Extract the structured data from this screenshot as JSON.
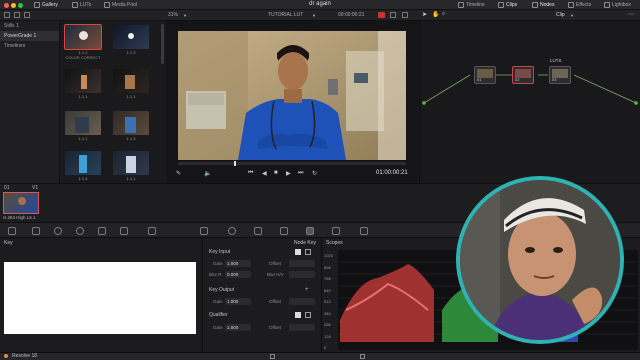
{
  "app": {
    "project_title": "dr again",
    "tabs": {
      "gallery": "Gallery",
      "luts": "LUTs",
      "media_pool": "Media Pool",
      "timeline": "Timeline",
      "clips": "Clips",
      "nodes": "Nodes",
      "effects": "Effects",
      "lightbox": "Lightbox"
    }
  },
  "viewer": {
    "zoom": "31%",
    "timeline_name": "TUTORIAL LUT",
    "timecode_top": "00:00:00:21",
    "timecode_bottom": "01:00:00:21",
    "mode": "Clip"
  },
  "sidebar": {
    "items": [
      {
        "label": "Stills 1"
      },
      {
        "label": "PowerGrade 1"
      },
      {
        "label": "Timelines"
      }
    ]
  },
  "gallery": {
    "stills": [
      {
        "label": "1.1.2",
        "sub": "COLOR CORRECT"
      },
      {
        "label": "1.1.3"
      },
      {
        "label": "1.1.1"
      },
      {
        "label": "1.1.1"
      },
      {
        "label": "1.1.1"
      },
      {
        "label": "1.1.3"
      },
      {
        "label": "1.1.4"
      },
      {
        "label": "1.1.1"
      }
    ]
  },
  "node_graph": {
    "nodes": [
      {
        "label": "01"
      },
      {
        "label": "02"
      },
      {
        "label": "03"
      }
    ],
    "luts_label": "LUTS"
  },
  "clip": {
    "number": "01",
    "track": "V1",
    "codec": "H.264 High L5.1"
  },
  "key_panel": {
    "title": "Key"
  },
  "node_key": {
    "title": "Node Key",
    "key_input": "Key Input",
    "key_output": "Key Output",
    "qualifier": "Qualifier",
    "gain_label": "Gain",
    "offset_label": "Offset",
    "blur_r_label": "Blur R.",
    "blur_hv_label": "Blur H/V",
    "gain_value": "1.000",
    "blur_value": "0.000",
    "output_gain_value": "1.000",
    "qualifier_gain_value": "1.000"
  },
  "scopes": {
    "title": "Scopes",
    "ticks": [
      "1023",
      "896",
      "768",
      "640",
      "512",
      "384",
      "256",
      "128",
      "0"
    ]
  },
  "bottom": {
    "label": "Resolve 18"
  }
}
